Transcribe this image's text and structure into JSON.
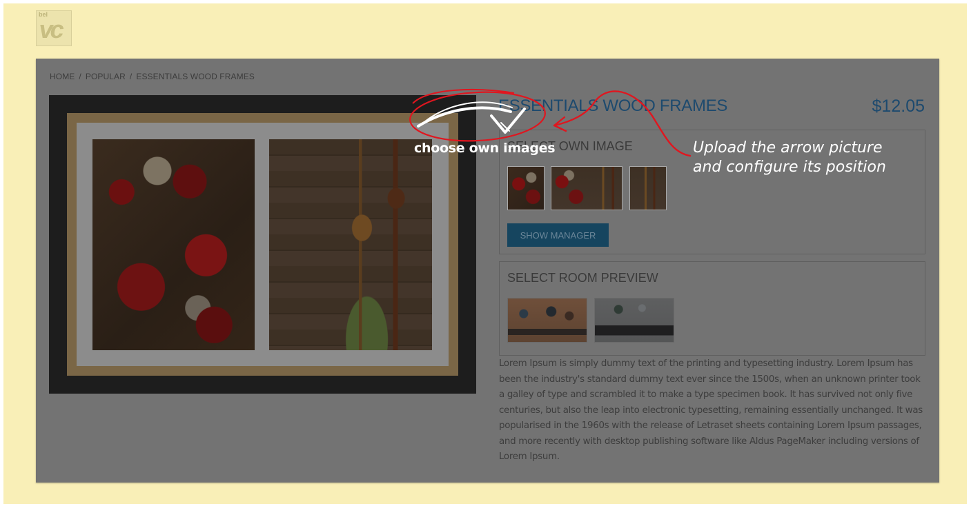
{
  "logo": {
    "small_text": "bel",
    "mark": "vc"
  },
  "breadcrumb": {
    "items": [
      "HOME",
      "POPULAR",
      "ESSENTIALS WOOD FRAMES"
    ],
    "separator": "/"
  },
  "product": {
    "title": "ESSENTIALS WOOD FRAMES",
    "price": "$12.05",
    "image_alt": "framed-vegetables-and-wooden-spoons"
  },
  "own_image": {
    "title": "SELECT OWN IMAGE",
    "thumbnails": [
      "vegetables",
      "vegetables-and-spoons",
      "spoons"
    ],
    "button_label": "SHOW MANAGER"
  },
  "room_preview": {
    "title": "SELECT ROOM PREVIEW",
    "thumbnails": [
      "room-brown-wall",
      "room-grey-wall"
    ]
  },
  "description": "Lorem Ipsum is simply dummy text of the printing and typesetting industry. Lorem Ipsum has been the industry's standard dummy text ever since the 1500s, when an unknown printer took a galley of type and scrambled it to make a type specimen book. It has survived not only five centuries, but also the leap into electronic typesetting, remaining essentially unchanged. It was popularised in the 1960s with the release of Letraset sheets containing Lorem Ipsum passages, and more recently with desktop publishing software like Aldus PageMaker including versions of Lorem Ipsum.",
  "annotations": {
    "choose_label": "choose own images",
    "upload_note_line1": "Upload the arrow picture",
    "upload_note_line2": "and configure its position"
  },
  "colors": {
    "page_background": "#f9efb7",
    "overlay": "#737373",
    "title_accent": "#1d4a6e",
    "button": "#16455f",
    "annotation_red": "#e0161f"
  },
  "icons": {
    "arrow_icon": "curved-white-arrow-icon",
    "checkmark_icon": "checkmark-icon"
  }
}
